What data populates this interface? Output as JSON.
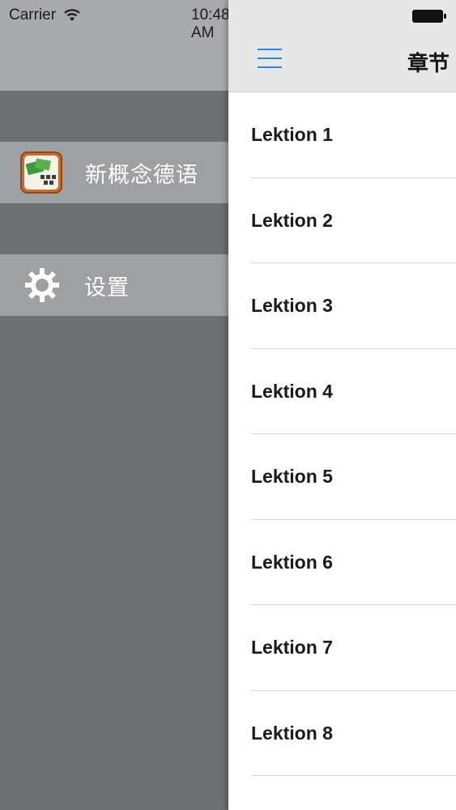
{
  "status_bar": {
    "carrier": "Carrier",
    "time": "10:48 AM"
  },
  "drawer": {
    "items": [
      {
        "label": "新概念德语",
        "icon": "app-book-icon"
      },
      {
        "label": "设置",
        "icon": "gear-icon"
      }
    ]
  },
  "main": {
    "title": "章节",
    "menu_icon": "hamburger-menu-icon",
    "lessons": [
      {
        "label": "Lektion 1"
      },
      {
        "label": "Lektion 2"
      },
      {
        "label": "Lektion 3"
      },
      {
        "label": "Lektion 4"
      },
      {
        "label": "Lektion 5"
      },
      {
        "label": "Lektion 6"
      },
      {
        "label": "Lektion 7"
      },
      {
        "label": "Lektion 8"
      }
    ]
  },
  "colors": {
    "accent": "#2e8ad8",
    "drawer_bg": "#6d6f70",
    "drawer_item_bg": "#9fa0a1"
  }
}
